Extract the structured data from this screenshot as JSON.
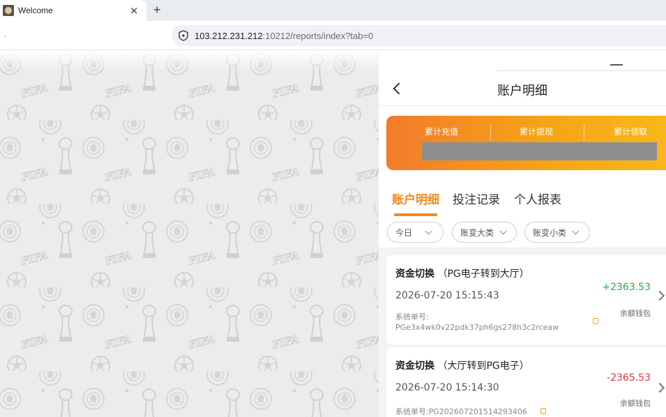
{
  "browser": {
    "tab_title": "Welcome",
    "tab_close": "×",
    "new_tab": "+",
    "url_host": "103.212.231.212",
    "url_rest": ":10212/reports/index?tab=0"
  },
  "bg_pattern": {
    "logo_text": "FIFA",
    "icons": [
      "soccer-ball-icon",
      "trophy-icon",
      "emblem-icon"
    ]
  },
  "header": {
    "title": "账户明细"
  },
  "summary": {
    "labels": [
      "累计充值",
      "累计提现",
      "累计领取"
    ],
    "gradient_colors": [
      "#f27b2a",
      "#f8b81a"
    ],
    "value_redacted_color": "#8e8e8e"
  },
  "tabs": [
    {
      "label": "账户明细",
      "active": true
    },
    {
      "label": "投注记录",
      "active": false
    },
    {
      "label": "个人报表",
      "active": false
    }
  ],
  "filters": [
    {
      "label": "今日"
    },
    {
      "label": "账变大类"
    },
    {
      "label": "账变小类"
    }
  ],
  "records": [
    {
      "type": "资金切换",
      "detail": "（PG电子转到大厅）",
      "time": "2026-07-20 15:15:43",
      "order_label": "系统单号:",
      "order_no": "PGe3x4wk0v22pdk37ph6gs278h3c2rceaw",
      "amount": "+2363.53",
      "wallet": "余额钱包"
    },
    {
      "type": "资金切换",
      "detail": "（大厅转到PG电子）",
      "time": "2026-07-20 15:14:30",
      "order_label": "系统单号:",
      "order_no": "PG202607201514293406",
      "amount": "-2365.53",
      "wallet": "余额钱包"
    }
  ],
  "colors": {
    "accent": "#f08a1c",
    "positive": "#2fa84f",
    "negative": "#e2353a"
  }
}
